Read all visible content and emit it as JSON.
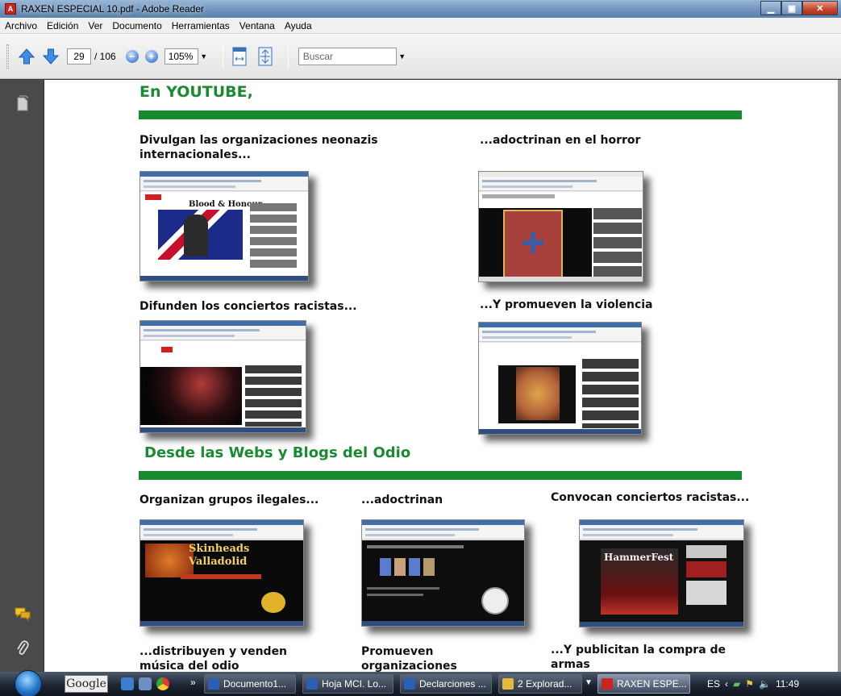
{
  "window": {
    "title": "RAXEN ESPECIAL 10.pdf - Adobe Reader"
  },
  "menu": [
    "Archivo",
    "Edición",
    "Ver",
    "Documento",
    "Herramientas",
    "Ventana",
    "Ayuda"
  ],
  "toolbar": {
    "page_current": "29",
    "page_total": "/ 106",
    "zoom": "105%",
    "search_placeholder": "Buscar"
  },
  "document": {
    "section1_title": "En YOUTUBE,",
    "section2_title": "Desde las Webs y Blogs del Odio",
    "captions": {
      "c1": "Divulgan las organizaciones neonazis internacionales...",
      "c2": "...adoctrinan en el horror",
      "c3": "Difunden los conciertos  racistas...",
      "c4": "...Y promueven la violencia",
      "c5": "Organizan grupos ilegales...",
      "c6": "...adoctrinan",
      "c7": "Convocan conciertos racistas...",
      "c8": "...distribuyen y venden música del odio",
      "c9": "Promueven organizaciones",
      "c10": "...Y publicitan la compra de armas"
    },
    "thumb_texts": {
      "t1": "Blood & Honour",
      "t5a": "Skinheads",
      "t5b": "Valladolid",
      "t7": "HammerFest"
    }
  },
  "taskbar": {
    "google": "Google",
    "tasks": [
      "Documento1...",
      "Hoja MCI. Lo...",
      "Declarciones ...",
      "2 Explorad...",
      "RAXEN ESPE..."
    ],
    "tray_lang": "ES",
    "clock": "11:49"
  },
  "colors": {
    "accent_green": "#17892e",
    "title_green": "#1a8b30",
    "nav_panel": "#4a4a4a"
  }
}
